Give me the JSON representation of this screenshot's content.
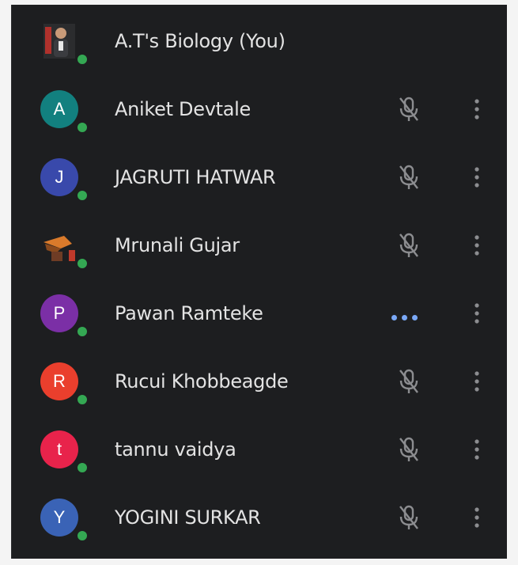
{
  "participants": [
    {
      "name": "A.T's Biology (You)",
      "initial": "",
      "avatar_color": "",
      "avatar_kind": "photo",
      "mic": "none",
      "has_menu": false
    },
    {
      "name": "Aniket Devtale",
      "initial": "A",
      "avatar_color": "#12807f",
      "avatar_kind": "letter",
      "mic": "muted",
      "has_menu": true
    },
    {
      "name": "JAGRUTI HATWAR",
      "initial": "J",
      "avatar_color": "#3949ab",
      "avatar_kind": "letter",
      "mic": "muted",
      "has_menu": true
    },
    {
      "name": "Mrunali Gujar",
      "initial": "",
      "avatar_color": "",
      "avatar_kind": "photo",
      "mic": "muted",
      "has_menu": true
    },
    {
      "name": "Pawan Ramteke",
      "initial": "P",
      "avatar_color": "#7b2fa6",
      "avatar_kind": "letter",
      "mic": "speaking",
      "has_menu": true
    },
    {
      "name": "Rucui Khobbeagde",
      "initial": "R",
      "avatar_color": "#ea3f2d",
      "avatar_kind": "letter",
      "mic": "muted",
      "has_menu": true
    },
    {
      "name": "tannu vaidya",
      "initial": "t",
      "avatar_color": "#e8234b",
      "avatar_kind": "letter",
      "mic": "muted",
      "has_menu": true
    },
    {
      "name": "YOGINI SURKAR",
      "initial": "Y",
      "avatar_color": "#3a63b6",
      "avatar_kind": "letter",
      "mic": "muted",
      "has_menu": true
    }
  ],
  "colors": {
    "panel_background": "#1d1e20",
    "text": "#e3e3e3",
    "online_dot": "#34a853",
    "speaking_dots": "#7aa8f6",
    "icon_gray": "#8c8d90"
  }
}
